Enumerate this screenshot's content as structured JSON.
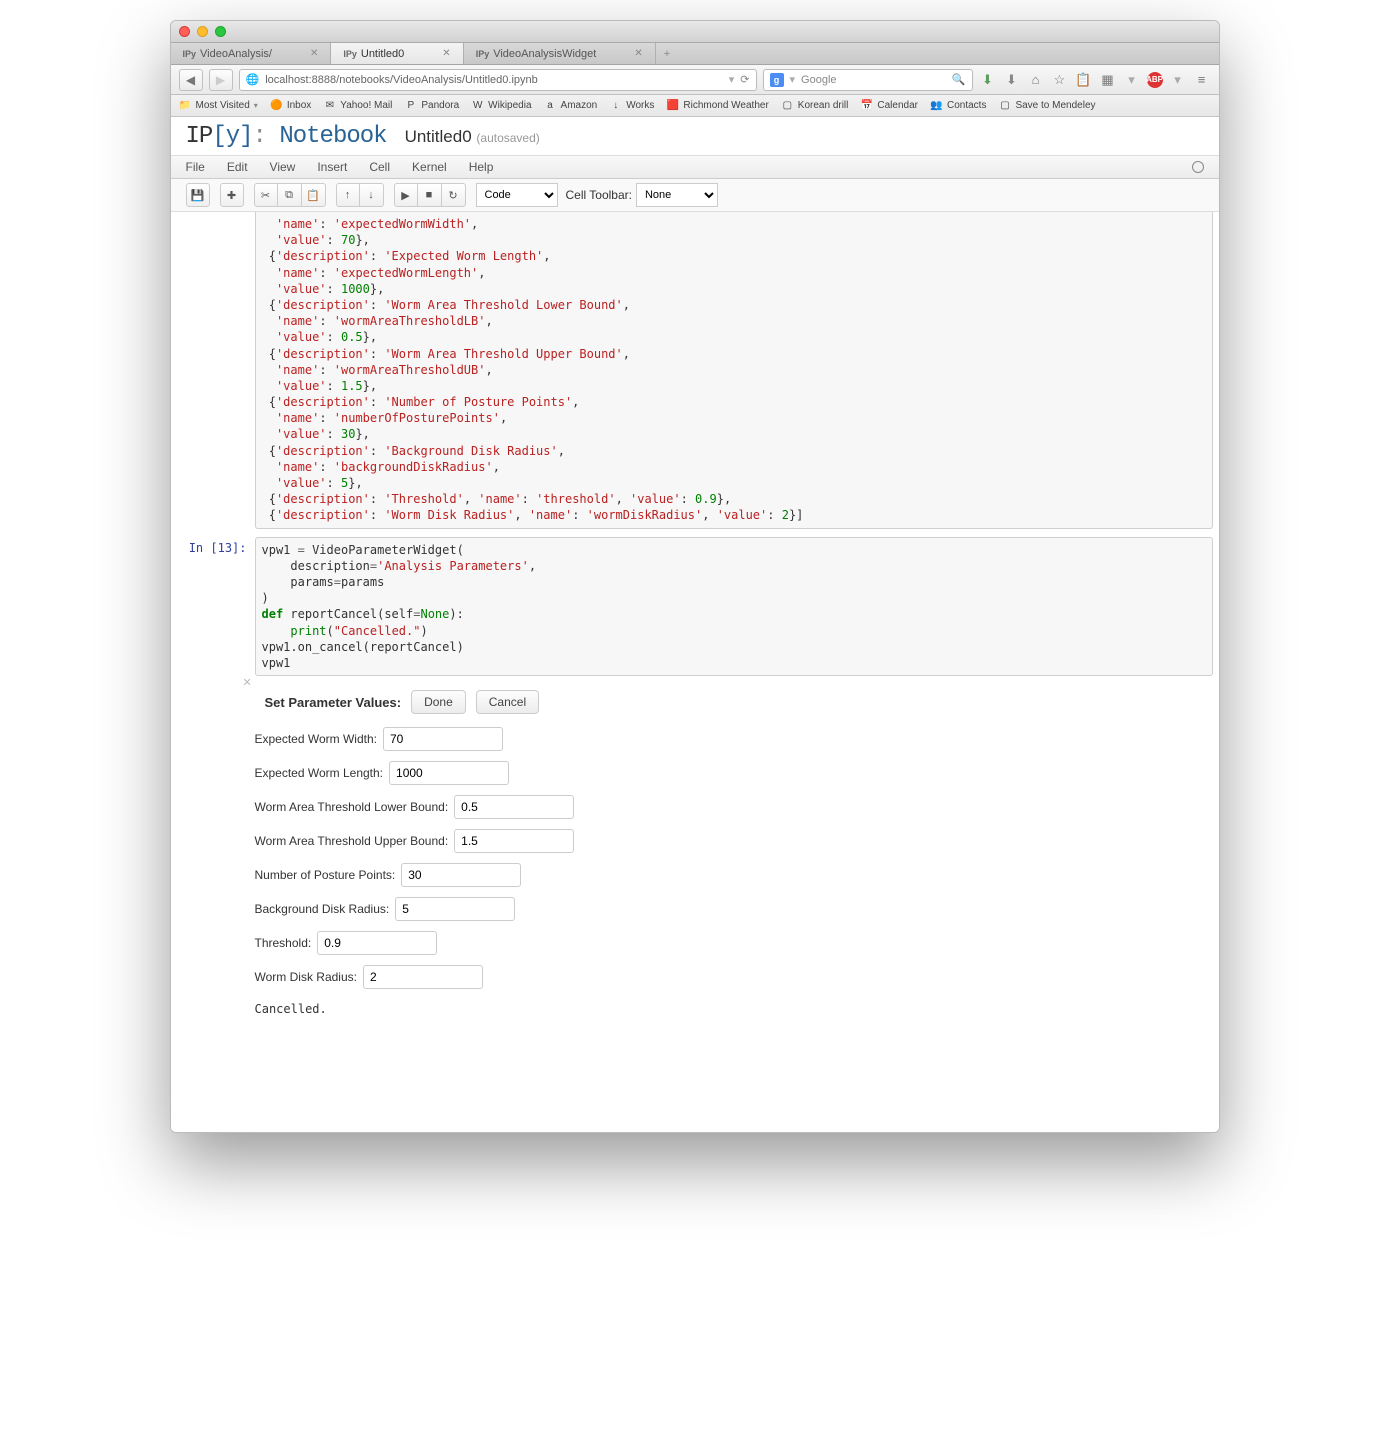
{
  "browser": {
    "tabs": [
      {
        "fav": "IPy",
        "title": "VideoAnalysis/",
        "active": false
      },
      {
        "fav": "IPy",
        "title": "Untitled0",
        "active": true
      },
      {
        "fav": "IPy",
        "title": "VideoAnalysisWidget",
        "active": false
      }
    ],
    "url": "localhost:8888/notebooks/VideoAnalysis/Untitled0.ipynb",
    "search_placeholder": "Google",
    "bookmarks": [
      {
        "icon": "📁",
        "label": "Most Visited",
        "dd": true
      },
      {
        "icon": "🟠",
        "label": "Inbox"
      },
      {
        "icon": "✉",
        "label": "Yahoo! Mail"
      },
      {
        "icon": "P",
        "label": "Pandora"
      },
      {
        "icon": "W",
        "label": "Wikipedia"
      },
      {
        "icon": "a",
        "label": "Amazon"
      },
      {
        "icon": "↓",
        "label": "Works"
      },
      {
        "icon": "🟥",
        "label": "Richmond Weather"
      },
      {
        "icon": "▢",
        "label": "Korean drill"
      },
      {
        "icon": "📅",
        "label": "Calendar"
      },
      {
        "icon": "👥",
        "label": "Contacts"
      },
      {
        "icon": "▢",
        "label": "Save to Mendeley"
      }
    ]
  },
  "notebook": {
    "logo_ip": "IP",
    "logo_y": "[y]",
    "logo_colon": ":",
    "logo_nb": "Notebook",
    "title": "Untitled0",
    "status": "(autosaved)",
    "menus": [
      "File",
      "Edit",
      "View",
      "Insert",
      "Cell",
      "Kernel",
      "Help"
    ],
    "celltype": "Code",
    "celltoolbar_label": "Cell Toolbar:",
    "celltoolbar_value": "None"
  },
  "code_cell1_lines": [
    [
      [
        "  ",
        "pn"
      ],
      [
        "'name'",
        "str"
      ],
      [
        ": ",
        "pn"
      ],
      [
        "'expectedWormWidth'",
        "str"
      ],
      [
        ",",
        "pn"
      ]
    ],
    [
      [
        "  ",
        "pn"
      ],
      [
        "'value'",
        "str"
      ],
      [
        ": ",
        "pn"
      ],
      [
        "70",
        "num"
      ],
      [
        "},",
        "pn"
      ]
    ],
    [
      [
        " {",
        "pn"
      ],
      [
        "'description'",
        "str"
      ],
      [
        ": ",
        "pn"
      ],
      [
        "'Expected Worm Length'",
        "str"
      ],
      [
        ",",
        "pn"
      ]
    ],
    [
      [
        "  ",
        "pn"
      ],
      [
        "'name'",
        "str"
      ],
      [
        ": ",
        "pn"
      ],
      [
        "'expectedWormLength'",
        "str"
      ],
      [
        ",",
        "pn"
      ]
    ],
    [
      [
        "  ",
        "pn"
      ],
      [
        "'value'",
        "str"
      ],
      [
        ": ",
        "pn"
      ],
      [
        "1000",
        "num"
      ],
      [
        "},",
        "pn"
      ]
    ],
    [
      [
        " {",
        "pn"
      ],
      [
        "'description'",
        "str"
      ],
      [
        ": ",
        "pn"
      ],
      [
        "'Worm Area Threshold Lower Bound'",
        "str"
      ],
      [
        ",",
        "pn"
      ]
    ],
    [
      [
        "  ",
        "pn"
      ],
      [
        "'name'",
        "str"
      ],
      [
        ": ",
        "pn"
      ],
      [
        "'wormAreaThresholdLB'",
        "str"
      ],
      [
        ",",
        "pn"
      ]
    ],
    [
      [
        "  ",
        "pn"
      ],
      [
        "'value'",
        "str"
      ],
      [
        ": ",
        "pn"
      ],
      [
        "0.5",
        "num"
      ],
      [
        "},",
        "pn"
      ]
    ],
    [
      [
        " {",
        "pn"
      ],
      [
        "'description'",
        "str"
      ],
      [
        ": ",
        "pn"
      ],
      [
        "'Worm Area Threshold Upper Bound'",
        "str"
      ],
      [
        ",",
        "pn"
      ]
    ],
    [
      [
        "  ",
        "pn"
      ],
      [
        "'name'",
        "str"
      ],
      [
        ": ",
        "pn"
      ],
      [
        "'wormAreaThresholdUB'",
        "str"
      ],
      [
        ",",
        "pn"
      ]
    ],
    [
      [
        "  ",
        "pn"
      ],
      [
        "'value'",
        "str"
      ],
      [
        ": ",
        "pn"
      ],
      [
        "1.5",
        "num"
      ],
      [
        "},",
        "pn"
      ]
    ],
    [
      [
        " {",
        "pn"
      ],
      [
        "'description'",
        "str"
      ],
      [
        ": ",
        "pn"
      ],
      [
        "'Number of Posture Points'",
        "str"
      ],
      [
        ",",
        "pn"
      ]
    ],
    [
      [
        "  ",
        "pn"
      ],
      [
        "'name'",
        "str"
      ],
      [
        ": ",
        "pn"
      ],
      [
        "'numberOfPosturePoints'",
        "str"
      ],
      [
        ",",
        "pn"
      ]
    ],
    [
      [
        "  ",
        "pn"
      ],
      [
        "'value'",
        "str"
      ],
      [
        ": ",
        "pn"
      ],
      [
        "30",
        "num"
      ],
      [
        "},",
        "pn"
      ]
    ],
    [
      [
        " {",
        "pn"
      ],
      [
        "'description'",
        "str"
      ],
      [
        ": ",
        "pn"
      ],
      [
        "'Background Disk Radius'",
        "str"
      ],
      [
        ",",
        "pn"
      ]
    ],
    [
      [
        "  ",
        "pn"
      ],
      [
        "'name'",
        "str"
      ],
      [
        ": ",
        "pn"
      ],
      [
        "'backgroundDiskRadius'",
        "str"
      ],
      [
        ",",
        "pn"
      ]
    ],
    [
      [
        "  ",
        "pn"
      ],
      [
        "'value'",
        "str"
      ],
      [
        ": ",
        "pn"
      ],
      [
        "5",
        "num"
      ],
      [
        "},",
        "pn"
      ]
    ],
    [
      [
        " {",
        "pn"
      ],
      [
        "'description'",
        "str"
      ],
      [
        ": ",
        "pn"
      ],
      [
        "'Threshold'",
        "str"
      ],
      [
        ", ",
        "pn"
      ],
      [
        "'name'",
        "str"
      ],
      [
        ": ",
        "pn"
      ],
      [
        "'threshold'",
        "str"
      ],
      [
        ", ",
        "pn"
      ],
      [
        "'value'",
        "str"
      ],
      [
        ": ",
        "pn"
      ],
      [
        "0.9",
        "num"
      ],
      [
        "},",
        "pn"
      ]
    ],
    [
      [
        " {",
        "pn"
      ],
      [
        "'description'",
        "str"
      ],
      [
        ": ",
        "pn"
      ],
      [
        "'Worm Disk Radius'",
        "str"
      ],
      [
        ", ",
        "pn"
      ],
      [
        "'name'",
        "str"
      ],
      [
        ": ",
        "pn"
      ],
      [
        "'wormDiskRadius'",
        "str"
      ],
      [
        ", ",
        "pn"
      ],
      [
        "'value'",
        "str"
      ],
      [
        ": ",
        "pn"
      ],
      [
        "2",
        "num"
      ],
      [
        "}]",
        "pn"
      ]
    ]
  ],
  "cell2_prompt": "In [13]:",
  "code_cell2_lines": [
    [
      [
        "vpw1 ",
        "pn"
      ],
      [
        "=",
        "op"
      ],
      [
        " VideoParameterWidget(",
        "pn"
      ]
    ],
    [
      [
        "    description",
        "pn"
      ],
      [
        "=",
        "op"
      ],
      [
        "'Analysis Parameters'",
        "str"
      ],
      [
        ",",
        "pn"
      ]
    ],
    [
      [
        "    params",
        "pn"
      ],
      [
        "=",
        "op"
      ],
      [
        "params",
        "pn"
      ]
    ],
    [
      [
        ")",
        "pn"
      ]
    ],
    [
      [
        "def ",
        "kw"
      ],
      [
        "reportCancel(self",
        "pn"
      ],
      [
        "=",
        "op"
      ],
      [
        "None",
        "bn"
      ],
      [
        "):",
        "pn"
      ]
    ],
    [
      [
        "    ",
        "pn"
      ],
      [
        "print",
        "bn"
      ],
      [
        "(",
        "pn"
      ],
      [
        "\"Cancelled.\"",
        "str"
      ],
      [
        ")",
        "pn"
      ]
    ],
    [
      [
        "vpw1.on_cancel(reportCancel)",
        "pn"
      ]
    ],
    [
      [
        "vpw1",
        "pn"
      ]
    ]
  ],
  "widget": {
    "title": "Set Parameter Values:",
    "done_label": "Done",
    "cancel_label": "Cancel",
    "fields": [
      {
        "label": "Expected Worm Width:",
        "value": "70"
      },
      {
        "label": "Expected Worm Length:",
        "value": "1000"
      },
      {
        "label": "Worm Area Threshold Lower Bound:",
        "value": "0.5"
      },
      {
        "label": "Worm Area Threshold Upper Bound:",
        "value": "1.5"
      },
      {
        "label": "Number of Posture Points:",
        "value": "30"
      },
      {
        "label": "Background Disk Radius:",
        "value": "5"
      },
      {
        "label": "Threshold:",
        "value": "0.9"
      },
      {
        "label": "Worm Disk Radius:",
        "value": "2"
      }
    ],
    "output_text": "Cancelled."
  }
}
